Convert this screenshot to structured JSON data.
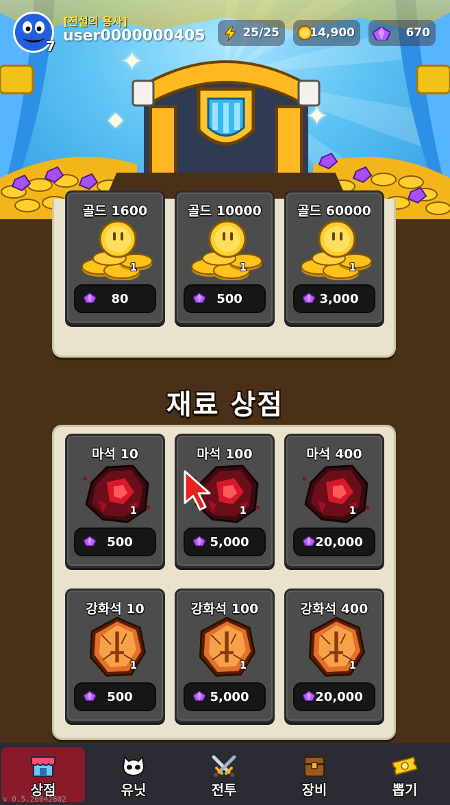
{
  "player": {
    "title": "[전설의 용사]",
    "username": "user0000000405",
    "level": "7"
  },
  "resources": {
    "energy": "25/25",
    "gold": "14,900",
    "gems": "670"
  },
  "gold_shop": {
    "items": [
      {
        "name": "골드 1600",
        "qty": "1",
        "price": "80"
      },
      {
        "name": "골드 10000",
        "qty": "1",
        "price": "500"
      },
      {
        "name": "골드 60000",
        "qty": "1",
        "price": "3,000"
      }
    ]
  },
  "material_shop": {
    "title": "재료 상점",
    "magic_stones": [
      {
        "name": "마석 10",
        "qty": "1",
        "price": "500"
      },
      {
        "name": "마석 100",
        "qty": "1",
        "price": "5,000"
      },
      {
        "name": "마석 400",
        "qty": "1",
        "price": "20,000"
      }
    ],
    "enhance_stones": [
      {
        "name": "강화석 10",
        "qty": "1",
        "price": "500"
      },
      {
        "name": "강화석 100",
        "qty": "1",
        "price": "5,000"
      },
      {
        "name": "강화석 400",
        "qty": "1",
        "price": "20,000"
      }
    ]
  },
  "nav": {
    "items": [
      {
        "label": "상점",
        "icon": "shop-icon",
        "active": true
      },
      {
        "label": "유닛",
        "icon": "skull-icon",
        "active": false
      },
      {
        "label": "전투",
        "icon": "swords-icon",
        "active": false
      },
      {
        "label": "장비",
        "icon": "chest-icon",
        "active": false
      },
      {
        "label": "뽑기",
        "icon": "ticket-icon",
        "active": false
      }
    ]
  },
  "version": "v 0.5.26042802",
  "colors": {
    "background": "#4a3018",
    "nav_active": "#8a1a2a",
    "gem": "#9b3fe0",
    "gold_text": "#ffe34a"
  }
}
